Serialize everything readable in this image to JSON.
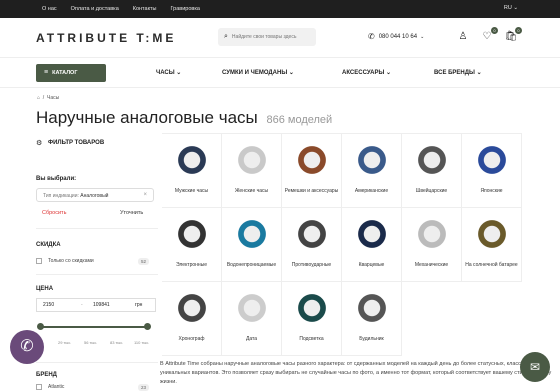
{
  "topbar": {
    "links": [
      "О нас",
      "Оплата и доставка",
      "Контакты",
      "Гравировка"
    ],
    "lang": "RU"
  },
  "header": {
    "logo": "ATTRIBUTE T:ME",
    "search_placeholder": "Найдите свои товары здесь",
    "phone": "080 044 10 64",
    "wishlist_count": "0",
    "cart_count": "0"
  },
  "nav": {
    "catalog": "КАТАЛОГ",
    "items": [
      "ЧАСЫ",
      "СУМКИ И ЧЕМОДАНЫ",
      "АКСЕССУАРЫ",
      "ВСЕ БРЕНДЫ"
    ]
  },
  "breadcrumb": {
    "current": "Часы"
  },
  "page": {
    "title": "Наручные аналоговые часы",
    "count": "866 моделей"
  },
  "filter": {
    "heading": "ФИЛЬТР ТОВАРОВ",
    "chosen": "Вы выбрали:",
    "chip_label": "Тип индикации:",
    "chip_value": "Аналоговый",
    "reset": "Сбросить",
    "apply": "Уточнить",
    "discount": {
      "title": "СКИДКА",
      "option": "Только со скидками",
      "count": "52"
    },
    "price": {
      "title": "ЦЕНА",
      "min": "2150",
      "max": "109841",
      "currency": "грн",
      "ticks": [
        "29 тыс.",
        "56 тыс.",
        "83 тыс.",
        "110 тыс."
      ]
    },
    "brand": {
      "title": "БРЕНД",
      "first": "Atlantic",
      "first_count": "23"
    }
  },
  "categories": [
    {
      "label": "Мужские часы",
      "color": "#2a3a55"
    },
    {
      "label": "Женские часы",
      "color": "#c9c9c9"
    },
    {
      "label": "Ремешки и аксессуары",
      "color": "#8a4a2a"
    },
    {
      "label": "Американские",
      "color": "#3a5a8a"
    },
    {
      "label": "Швейцарские",
      "color": "#555"
    },
    {
      "label": "Японские",
      "color": "#2a4a9a"
    },
    {
      "label": "Электронные",
      "color": "#333"
    },
    {
      "label": "Водонепроницаемые",
      "color": "#1a7aa0"
    },
    {
      "label": "Противоударные",
      "color": "#444"
    },
    {
      "label": "Кварцевые",
      "color": "#1a2a4a"
    },
    {
      "label": "Механические",
      "color": "#bbb"
    },
    {
      "label": "На солнечной батарее",
      "color": "#6a5a2a"
    },
    {
      "label": "Хронограф",
      "color": "#444"
    },
    {
      "label": "Дата",
      "color": "#ccc"
    },
    {
      "label": "Подсветка",
      "color": "#1a4a4a"
    },
    {
      "label": "Будильник",
      "color": "#555"
    }
  ],
  "description": "В Attribute Time собраны наручные аналоговые часы разного характера: от сдержанных моделей на каждый день до более статусных, классических и уникальных вариантов. Это позволяет сразу выбирать не случайные часы по фото, а именно тот формат, который соответствует вашему стилю и ритму жизни."
}
